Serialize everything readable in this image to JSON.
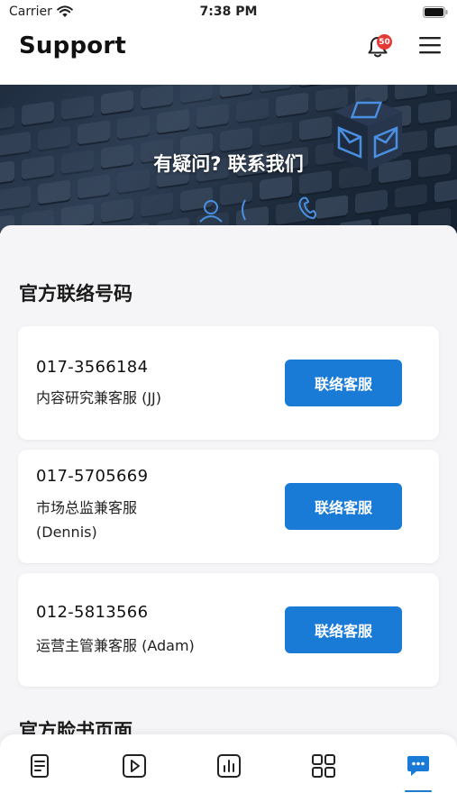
{
  "status_bar": {
    "carrier": "Carrier",
    "time": "7:38 PM"
  },
  "header": {
    "title": "Support",
    "notification_count": "50"
  },
  "banner": {
    "text": "有疑问? 联系我们"
  },
  "section": {
    "title": "官方联络号码"
  },
  "contacts": [
    {
      "phone": "017-3566184",
      "name": "内容研究兼客服 (JJ)",
      "button_label": "联络客服"
    },
    {
      "phone": "017-5705669",
      "name": "市场总监兼客服 (Dennis)",
      "button_label": "联络客服"
    },
    {
      "phone": "012-5813566",
      "name": "运营主管兼客服 (Adam)",
      "button_label": "联络客服"
    }
  ],
  "section2": {
    "title": "官方脸书页面"
  },
  "tabs": [
    {
      "icon": "document-icon",
      "active": false
    },
    {
      "icon": "video-play-icon",
      "active": false
    },
    {
      "icon": "bar-chart-icon",
      "active": false
    },
    {
      "icon": "grid-icon",
      "active": false
    },
    {
      "icon": "chat-icon",
      "active": true
    }
  ],
  "colors": {
    "accent": "#1a7bd6",
    "badge": "#e53935",
    "banner_bg": "#1f2d3f"
  }
}
